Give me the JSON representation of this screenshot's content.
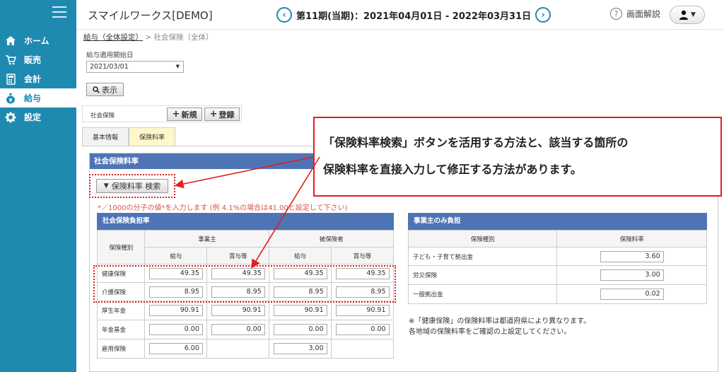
{
  "header": {
    "app_title": "スマイルワークス[DEMO]",
    "period": "第11期(当期)：2021年04月01日 - 2022年03月31日",
    "help_label": "画面解説",
    "prev_icon": "chevron-left-icon",
    "next_icon": "chevron-right-icon"
  },
  "sidebar": {
    "items": [
      {
        "label": "ホーム",
        "icon": "home-icon"
      },
      {
        "label": "販売",
        "icon": "cart-icon"
      },
      {
        "label": "会計",
        "icon": "calculator-icon"
      },
      {
        "label": "給与",
        "icon": "money-bag-icon"
      },
      {
        "label": "設定",
        "icon": "gear-icon"
      }
    ],
    "active_index": 3
  },
  "breadcrumb": {
    "link": "給与（全体設定）",
    "separator": ">",
    "current": "社会保険（全体）"
  },
  "form": {
    "date_label": "給与適用開始日",
    "date_value": "2021/03/01",
    "show_button": "表示",
    "insurance_label": "社会保険",
    "new_button": "新規",
    "register_button": "登録"
  },
  "tabs": [
    {
      "label": "基本情報"
    },
    {
      "label": "保険料率"
    }
  ],
  "section": {
    "title": "社会保険料率",
    "search_button": "保険料率 検索",
    "note": "*／1000の分子の値*を入力します (例 4.1%の場合は41.00と設定して下さい)"
  },
  "left_table": {
    "title": "社会保険負担率",
    "col_type": "保険種別",
    "group_employer": "事業主",
    "group_insured": "被保険者",
    "col_salary": "給与",
    "col_bonus": "賞与等",
    "rows": [
      {
        "label": "健康保険",
        "values": [
          "49.35",
          "49.35",
          "49.35",
          "49.35"
        ]
      },
      {
        "label": "介護保険",
        "values": [
          "8.95",
          "8.95",
          "8.95",
          "8.95"
        ]
      },
      {
        "label": "厚生年金",
        "values": [
          "90.91",
          "90.91",
          "90.91",
          "90.91"
        ]
      },
      {
        "label": "年金基金",
        "values": [
          "0.00",
          "0.00",
          "0.00",
          "0.00"
        ]
      },
      {
        "label": "雇用保険",
        "values": [
          "6.00",
          "",
          "3.00",
          ""
        ]
      }
    ]
  },
  "right_table": {
    "title": "事業主のみ負担",
    "col_type": "保険種別",
    "col_rate": "保険料率",
    "rows": [
      {
        "label": "子ども・子育て拠出金",
        "value": "3.60"
      },
      {
        "label": "労災保険",
        "value": "3.00"
      },
      {
        "label": "一般拠出金",
        "value": "0.02"
      }
    ]
  },
  "notes": {
    "line1": "※「健康保険」の保険料率は都道府県により異なります。",
    "line2": "各地域の保険料率をご確認の上設定してください。"
  },
  "callout": {
    "line1": "「保険料率検索」ボタンを活用する方法と、該当する箇所の",
    "line2": "保険料率を直接入力して修正する方法があります。"
  },
  "colors": {
    "sidebar": "#1f8ab0",
    "table_header": "#4f74b6",
    "highlight_red": "#e02020",
    "active_tab": "#fff6c9"
  }
}
